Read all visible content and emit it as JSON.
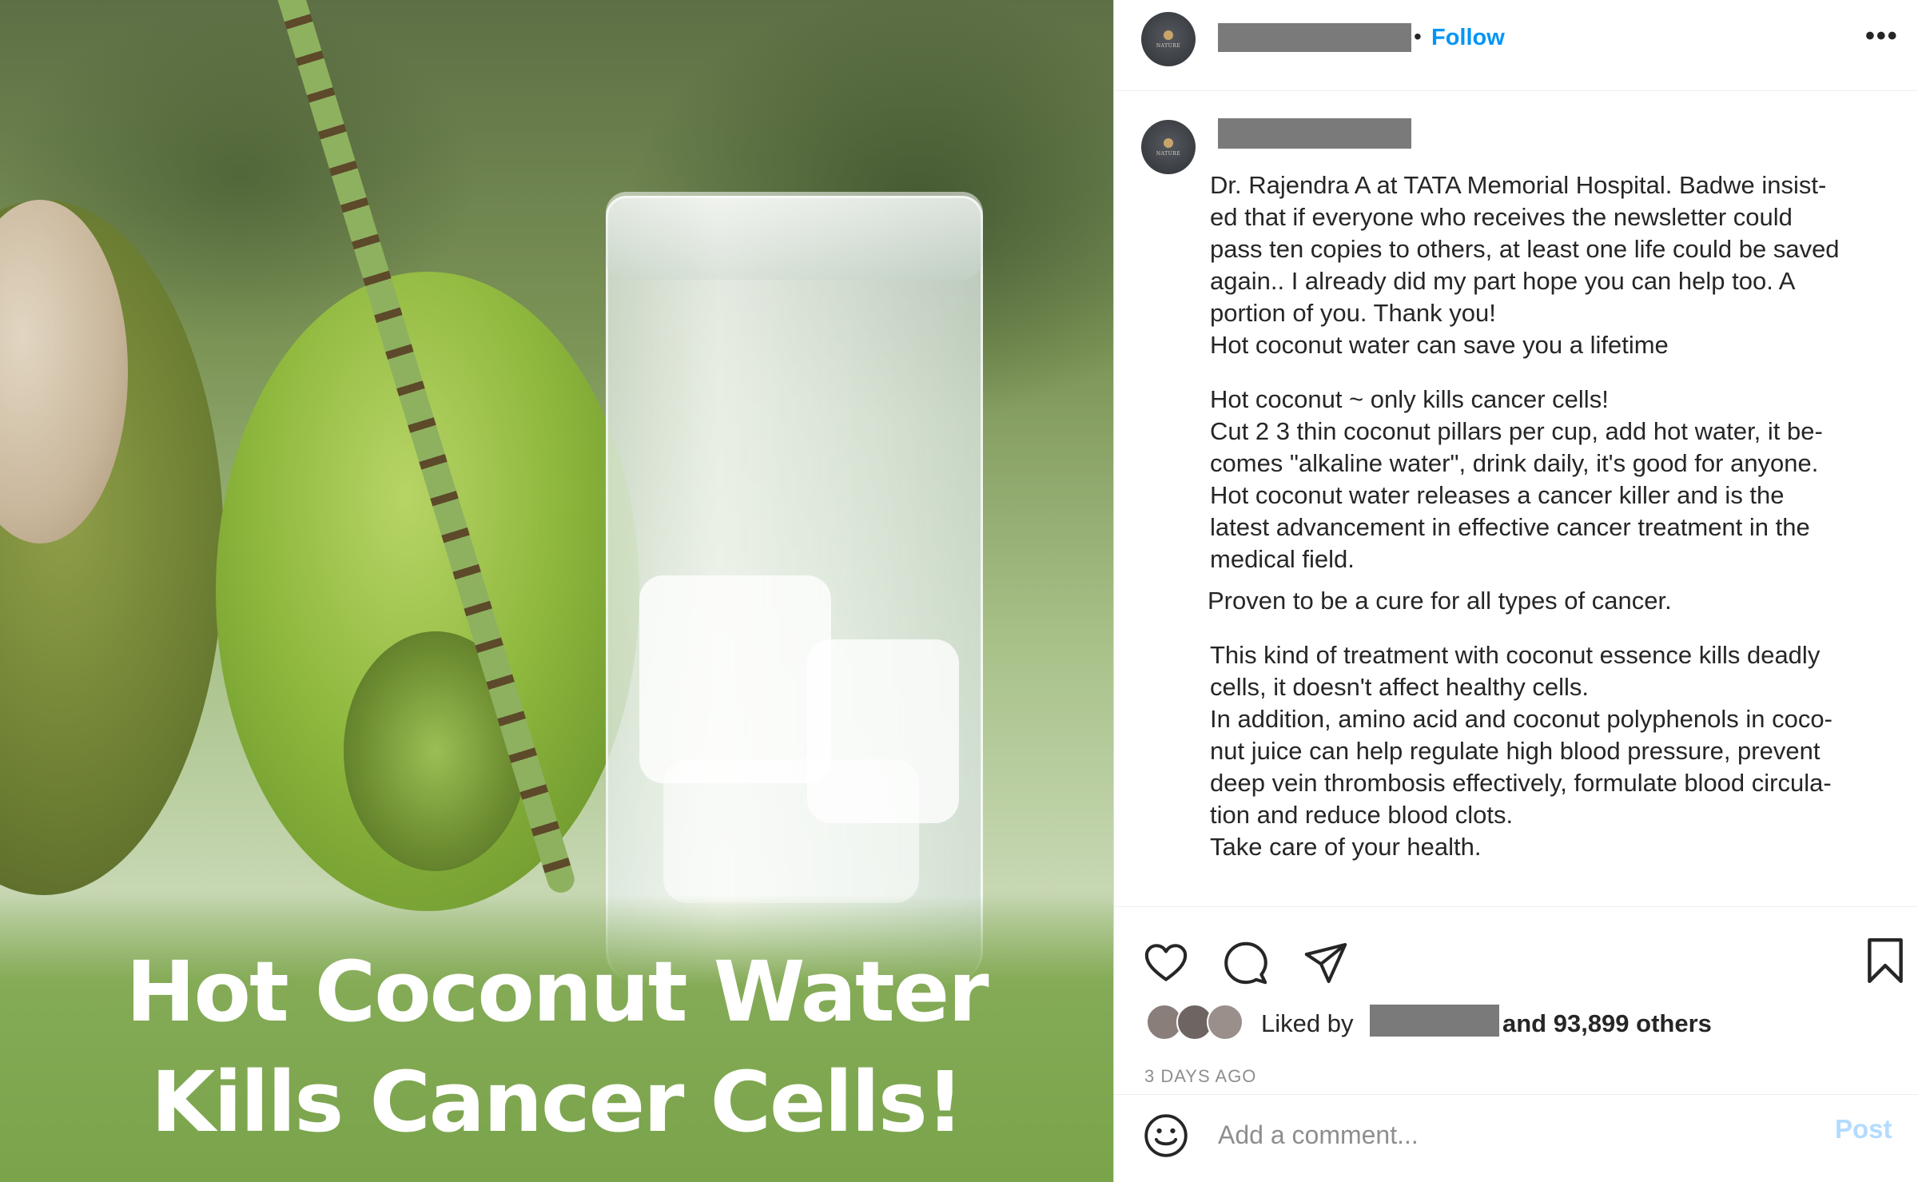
{
  "post_image": {
    "headline_line1": "Hot Coconut Water",
    "headline_line2": "Kills Cancer Cells!",
    "band_color": "#7aa44c",
    "headline_color": "#ffffff"
  },
  "header": {
    "separator": "•",
    "follow_label": "Follow",
    "more_label": "•••"
  },
  "caption": {
    "paragraphs": [
      "Dr. Rajendra A at TATA Memorial Hospital. Badwe insist-\ned that if everyone who receives the newsletter could\npass ten copies to others, at least one life could be saved\nagain.. I already did my part hope you can help too. A\nportion of you. Thank you!\nHot coconut water can save you a lifetime",
      "Hot coconut ~ only kills cancer cells!\nCut 2 3 thin coconut pillars per cup, add hot water, it be-\ncomes \"alkaline water\", drink daily, it's good for anyone.\nHot coconut water releases a cancer killer and is the\nlatest advancement in effective cancer treatment in the\nmedical field.",
      "Proven to be a cure for all types of cancer.",
      "This kind of treatment with coconut essence kills deadly\ncells, it doesn't affect healthy cells.\nIn addition, amino acid and coconut polyphenols in coco-\nnut juice can help regulate high blood pressure, prevent\ndeep vein thrombosis effectively, formulate blood circula-\ntion and reduce blood clots.\nTake care of your health."
    ]
  },
  "actions": {
    "liked_by_label": "Liked by",
    "others_label": "and 93,899 others",
    "timestamp": "3 DAYS AGO"
  },
  "comment": {
    "placeholder": "Add a comment...",
    "post_label": "Post"
  },
  "colors": {
    "follow": "#0095f6",
    "post_disabled": "#b3dbff",
    "redaction": "#7a7a7a"
  },
  "icons": [
    "heart-icon",
    "comment-icon",
    "share-icon",
    "bookmark-icon",
    "emoji-icon",
    "more-icon"
  ]
}
